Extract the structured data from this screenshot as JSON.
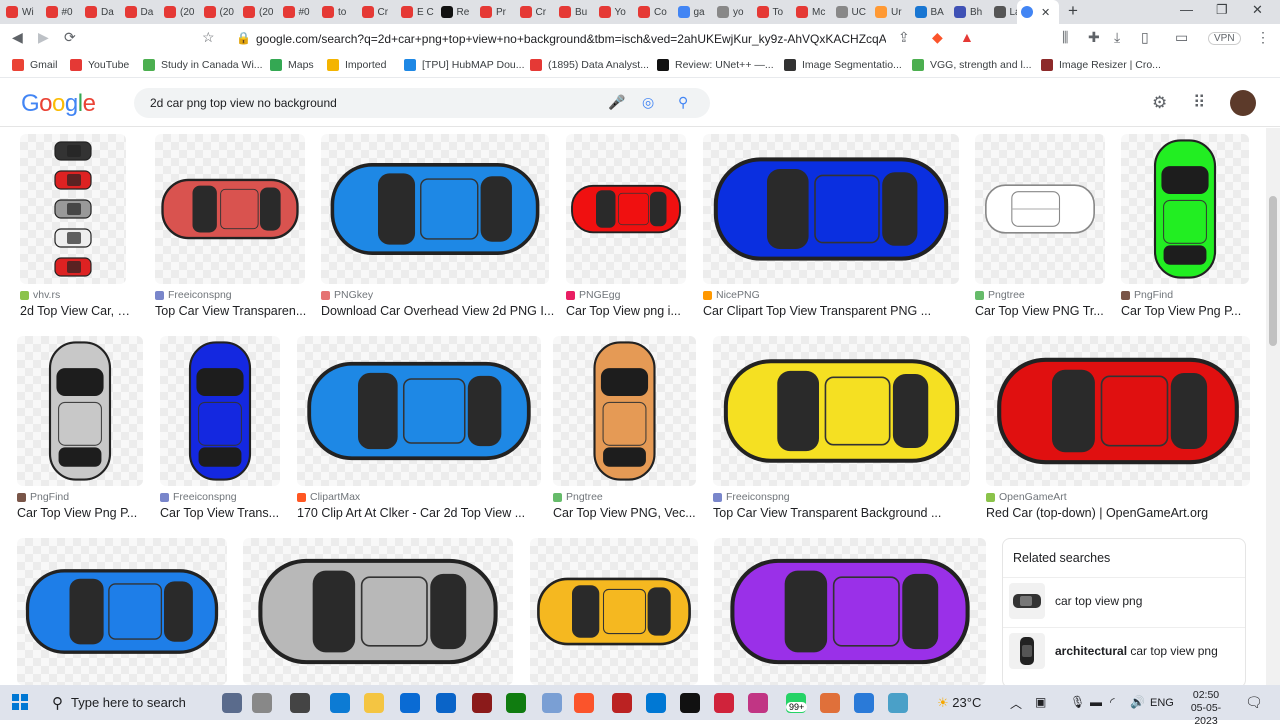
{
  "browser": {
    "tabs": [
      {
        "label": "Wi",
        "color": "#e53935"
      },
      {
        "label": "#0",
        "color": "#e53935"
      },
      {
        "label": "Da",
        "color": "#e53935"
      },
      {
        "label": "Da",
        "color": "#e53935"
      },
      {
        "label": "(20",
        "color": "#e53935"
      },
      {
        "label": "(20",
        "color": "#e53935"
      },
      {
        "label": "(20",
        "color": "#e53935"
      },
      {
        "label": "#0",
        "color": "#e53935"
      },
      {
        "label": "to",
        "color": "#e53935"
      },
      {
        "label": "Cr",
        "color": "#e53935"
      },
      {
        "label": "E C",
        "color": "#e53935"
      },
      {
        "label": "Re",
        "color": "#111111"
      },
      {
        "label": "Pr",
        "color": "#e53935"
      },
      {
        "label": "Cr",
        "color": "#e53935"
      },
      {
        "label": "Bu",
        "color": "#e53935"
      },
      {
        "label": "Yo",
        "color": "#e53935"
      },
      {
        "label": "Co",
        "color": "#e53935"
      },
      {
        "label": "ga",
        "color": "#4285f4"
      },
      {
        "label": "yo",
        "color": "#888888"
      },
      {
        "label": "To",
        "color": "#e53935"
      },
      {
        "label": "Mc",
        "color": "#e53935"
      },
      {
        "label": "UC",
        "color": "#888888"
      },
      {
        "label": "Ur",
        "color": "#ff9933"
      },
      {
        "label": "BA",
        "color": "#1976d2"
      },
      {
        "label": "Bh",
        "color": "#3f51b5"
      },
      {
        "label": "La",
        "color": "#555555"
      }
    ],
    "active_tab_close": "✕",
    "new_tab": "+",
    "url": "google.com/search?q=2d+car+png+top+view+no+background&tbm=isch&ved=2ahUKEwjKur_ky9z-AhVQxKACHZcqA...",
    "vpn": "VPN",
    "bookmarks": [
      {
        "label": "Gmail",
        "color": "#ea4335"
      },
      {
        "label": "YouTube",
        "color": "#e53935"
      },
      {
        "label": "Study in Canada Wi...",
        "color": "#4caf50"
      },
      {
        "label": "Maps",
        "color": "#34a853"
      },
      {
        "label": "Imported",
        "color": "#f4b400"
      },
      {
        "label": "[TPU] HubMAP Dou...",
        "color": "#1e88e5"
      },
      {
        "label": "(1895) Data Analyst...",
        "color": "#e53935"
      },
      {
        "label": "Review: UNet++ —...",
        "color": "#111111"
      },
      {
        "label": "Image Segmentatio...",
        "color": "#333333"
      },
      {
        "label": "VGG, strength and l...",
        "color": "#4caf50"
      },
      {
        "label": "Image Resizer | Cro...",
        "color": "#8d2a2a"
      }
    ]
  },
  "google": {
    "logo": "Google",
    "query": "2d car png top view no background"
  },
  "results": [
    {
      "source": "vhv.rs",
      "title": "2d Top View Car, H...",
      "src_color": "#8bc34a",
      "car": "stack"
    },
    {
      "source": "Freeiconspng",
      "title": "Top Car View Transparen...",
      "src_color": "#7986cb",
      "car": "#d9534f"
    },
    {
      "source": "PNGkey",
      "title": "Download Car Overhead View 2d PNG I...",
      "src_color": "#e57373",
      "car": "#1e88e5"
    },
    {
      "source": "PNGEgg",
      "title": "Car Top View png i...",
      "src_color": "#e91e63",
      "car": "#f01010"
    },
    {
      "source": "NicePNG",
      "title": "Car Clipart Top View Transparent PNG ...",
      "src_color": "#ff9800",
      "car": "#0a2fe0"
    },
    {
      "source": "Pngtree",
      "title": "Car Top View PNG Tr...",
      "src_color": "#66bb6a",
      "car": "outline"
    },
    {
      "source": "PngFind",
      "title": "Car Top View Png P...",
      "src_color": "#795548",
      "car": "#22ee22"
    },
    {
      "source": "PngFind",
      "title": "Car Top View Png P...",
      "src_color": "#795548",
      "car": "#c8c8c8"
    },
    {
      "source": "Freeiconspng",
      "title": "Car Top View Trans...",
      "src_color": "#7986cb",
      "car": "#1428e0"
    },
    {
      "source": "ClipartMax",
      "title": "170 Clip Art At Clker - Car 2d Top View ...",
      "src_color": "#ff5722",
      "car": "#1e88e5"
    },
    {
      "source": "Pngtree",
      "title": "Car Top View PNG, Vec...",
      "src_color": "#66bb6a",
      "car": "#e59a55"
    },
    {
      "source": "Freeiconspng",
      "title": "Top Car View Transparent Background ...",
      "src_color": "#7986cb",
      "car": "#f5e022"
    },
    {
      "source": "OpenGameArt",
      "title": "Red Car (top-down) | OpenGameArt.org",
      "src_color": "#8bc34a",
      "car": "#e01010"
    },
    {
      "source": "",
      "title": "",
      "src_color": "#ffffff",
      "car": "#1e7ee8"
    },
    {
      "source": "",
      "title": "",
      "src_color": "#ffffff",
      "car": "#b8b8b8"
    },
    {
      "source": "",
      "title": "",
      "src_color": "#ffffff",
      "car": "#f5b820"
    },
    {
      "source": "",
      "title": "",
      "src_color": "#ffffff",
      "car": "#9a30e8"
    }
  ],
  "related": {
    "heading": "Related searches",
    "items": [
      {
        "bold": "",
        "text": "car top view png"
      },
      {
        "bold": "architectural",
        "text": " car top view png"
      }
    ]
  },
  "taskbar": {
    "search_placeholder": "Type here to search",
    "badge": "99+",
    "weather": "23°C",
    "lang": "ENG",
    "time": "02:50",
    "date": "05-05-2023"
  }
}
